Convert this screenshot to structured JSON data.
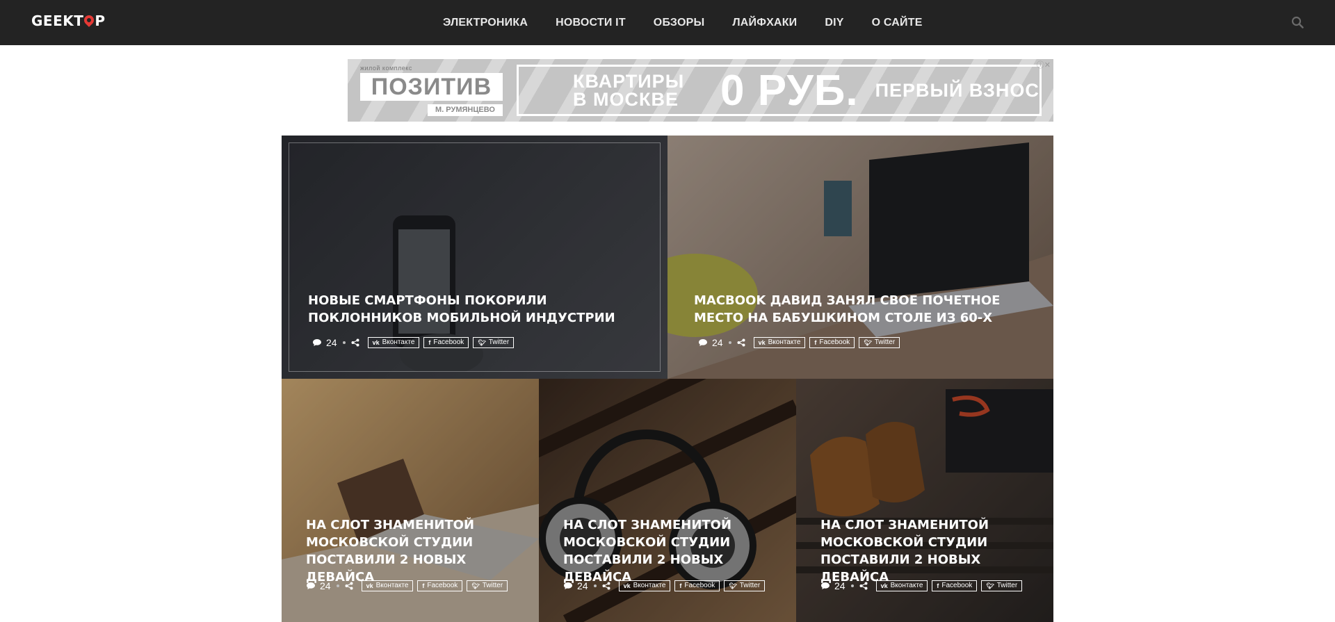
{
  "header": {
    "logo": {
      "left": "GEEKT",
      "right": "P"
    },
    "nav": [
      "ЭЛЕКТРОНИКА",
      "НОВОСТИ IT",
      "ОБЗОРЫ",
      "ЛАЙФХАКИ",
      "DIY",
      "О САЙТЕ"
    ],
    "search_icon": "search-icon"
  },
  "ad": {
    "brand_small": "жилой комплекс",
    "brand": "ПОЗИТИВ",
    "brand_sub": "М. РУМЯНЦЕВО",
    "line1": "КВАРТИРЫ В МОСКВЕ",
    "line2": "0 РУБ.",
    "line3": "ПЕРВЫЙ ВЗНОС",
    "close": "ⓘ✕"
  },
  "posts": [
    {
      "title": "НОВЫЕ СМАРТФОНЫ ПОКОРИЛИ ПОКЛОННИКОВ МОБИЛЬНОЙ ИНДУСТРИИ",
      "comments": "24",
      "share": {
        "vk": "Вконтакте",
        "fb": "Facebook",
        "tw": "Twitter"
      },
      "colors": [
        "#2e3036",
        "#4a4c52"
      ]
    },
    {
      "title": "MACBOOK ДАВИД ЗАНЯЛ СВОЕ ПОЧЕТНОЕ МЕСТО НА БАБУШКИНОМ СТОЛЕ ИЗ 60-Х",
      "comments": "24",
      "share": {
        "vk": "Вконтакте",
        "fb": "Facebook",
        "tw": "Twitter"
      },
      "colors": [
        "#b9a89a",
        "#6e5b4d"
      ]
    },
    {
      "title": "НА СЛОТ ЗНАМЕНИТОЙ МОСКОВСКОЙ СТУДИИ ПОСТАВИЛИ 2 НОВЫХ ДЕВАЙСА",
      "comments": "24",
      "share": {
        "vk": "Вконтакте",
        "fb": "Facebook",
        "tw": "Twitter"
      },
      "colors": [
        "#d9b27a",
        "#7a5a3a"
      ]
    },
    {
      "title": "НА СЛОТ ЗНАМЕНИТОЙ МОСКОВСКОЙ СТУДИИ ПОСТАВИЛИ 2 НОВЫХ ДЕВАЙСА",
      "comments": "24",
      "share": {
        "vk": "Вконтакте",
        "fb": "Facebook",
        "tw": "Twitter"
      },
      "colors": [
        "#3a2a20",
        "#8a6a4a"
      ]
    },
    {
      "title": "НА СЛОТ ЗНАМЕНИТОЙ МОСКОВСКОЙ СТУДИИ ПОСТАВИЛИ 2 НОВЫХ ДЕВАЙСА",
      "comments": "24",
      "share": {
        "vk": "Вконтакте",
        "fb": "Facebook",
        "tw": "Twitter"
      },
      "colors": [
        "#5a4a40",
        "#2a2624"
      ]
    }
  ]
}
